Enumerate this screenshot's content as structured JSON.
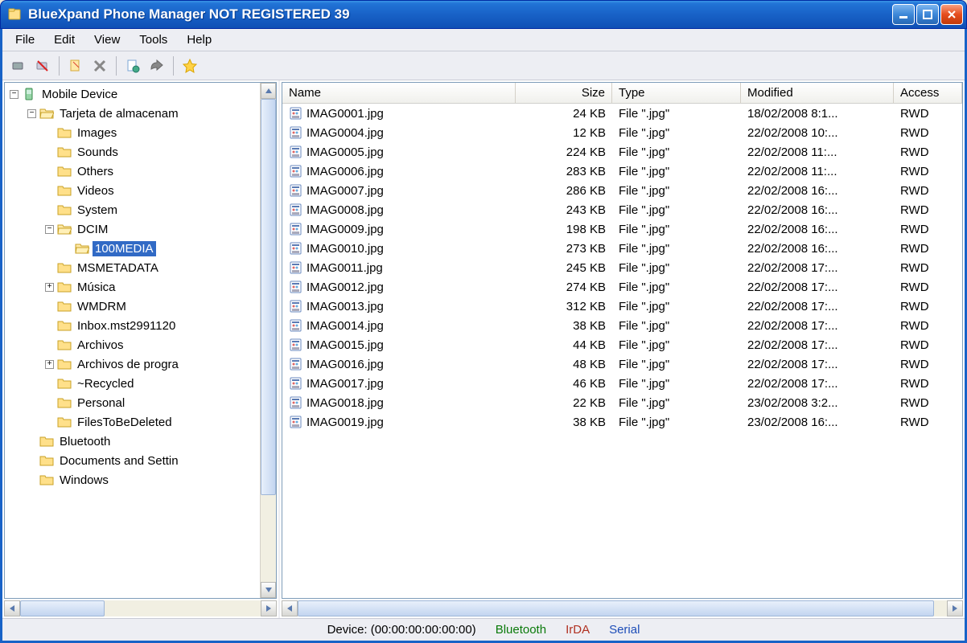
{
  "window": {
    "title": "BlueXpand Phone Manager   NOT REGISTERED 39"
  },
  "menu": {
    "file": "File",
    "edit": "Edit",
    "view": "View",
    "tools": "Tools",
    "help": "Help"
  },
  "tree": {
    "root": "Mobile Device",
    "storage": "Tarjeta de almacenam",
    "images": "Images",
    "sounds": "Sounds",
    "others": "Others",
    "videos": "Videos",
    "system": "System",
    "dcim": "DCIM",
    "media": "100MEDIA",
    "msmeta": "MSMETADATA",
    "musica": "Música",
    "wmdrm": "WMDRM",
    "inbox": "Inbox.mst2991120",
    "archivos": "Archivos",
    "progra": "Archivos de progra",
    "recycled": "~Recycled",
    "personal": "Personal",
    "filesdel": "FilesToBeDeleted",
    "bluetooth": "Bluetooth",
    "docsettings": "Documents and Settin",
    "windows": "Windows"
  },
  "list": {
    "headers": {
      "name": "Name",
      "size": "Size",
      "type": "Type",
      "modified": "Modified",
      "access": "Access"
    },
    "rows": [
      {
        "name": "IMAG0001.jpg",
        "size": "24 KB",
        "type": "File \".jpg\"",
        "modified": "18/02/2008 8:1...",
        "access": "RWD"
      },
      {
        "name": "IMAG0004.jpg",
        "size": "12 KB",
        "type": "File \".jpg\"",
        "modified": "22/02/2008 10:...",
        "access": "RWD"
      },
      {
        "name": "IMAG0005.jpg",
        "size": "224 KB",
        "type": "File \".jpg\"",
        "modified": "22/02/2008 11:...",
        "access": "RWD"
      },
      {
        "name": "IMAG0006.jpg",
        "size": "283 KB",
        "type": "File \".jpg\"",
        "modified": "22/02/2008 11:...",
        "access": "RWD"
      },
      {
        "name": "IMAG0007.jpg",
        "size": "286 KB",
        "type": "File \".jpg\"",
        "modified": "22/02/2008 16:...",
        "access": "RWD"
      },
      {
        "name": "IMAG0008.jpg",
        "size": "243 KB",
        "type": "File \".jpg\"",
        "modified": "22/02/2008 16:...",
        "access": "RWD"
      },
      {
        "name": "IMAG0009.jpg",
        "size": "198 KB",
        "type": "File \".jpg\"",
        "modified": "22/02/2008 16:...",
        "access": "RWD"
      },
      {
        "name": "IMAG0010.jpg",
        "size": "273 KB",
        "type": "File \".jpg\"",
        "modified": "22/02/2008 16:...",
        "access": "RWD"
      },
      {
        "name": "IMAG0011.jpg",
        "size": "245 KB",
        "type": "File \".jpg\"",
        "modified": "22/02/2008 17:...",
        "access": "RWD"
      },
      {
        "name": "IMAG0012.jpg",
        "size": "274 KB",
        "type": "File \".jpg\"",
        "modified": "22/02/2008 17:...",
        "access": "RWD"
      },
      {
        "name": "IMAG0013.jpg",
        "size": "312 KB",
        "type": "File \".jpg\"",
        "modified": "22/02/2008 17:...",
        "access": "RWD"
      },
      {
        "name": "IMAG0014.jpg",
        "size": "38 KB",
        "type": "File \".jpg\"",
        "modified": "22/02/2008 17:...",
        "access": "RWD"
      },
      {
        "name": "IMAG0015.jpg",
        "size": "44 KB",
        "type": "File \".jpg\"",
        "modified": "22/02/2008 17:...",
        "access": "RWD"
      },
      {
        "name": "IMAG0016.jpg",
        "size": "48 KB",
        "type": "File \".jpg\"",
        "modified": "22/02/2008 17:...",
        "access": "RWD"
      },
      {
        "name": "IMAG0017.jpg",
        "size": "46 KB",
        "type": "File \".jpg\"",
        "modified": "22/02/2008 17:...",
        "access": "RWD"
      },
      {
        "name": "IMAG0018.jpg",
        "size": "22 KB",
        "type": "File \".jpg\"",
        "modified": "23/02/2008 3:2...",
        "access": "RWD"
      },
      {
        "name": "IMAG0019.jpg",
        "size": "38 KB",
        "type": "File \".jpg\"",
        "modified": "23/02/2008 16:...",
        "access": "RWD"
      }
    ]
  },
  "status": {
    "device": "Device: (00:00:00:00:00:00)",
    "bluetooth": "Bluetooth",
    "irda": "IrDA",
    "serial": "Serial"
  }
}
